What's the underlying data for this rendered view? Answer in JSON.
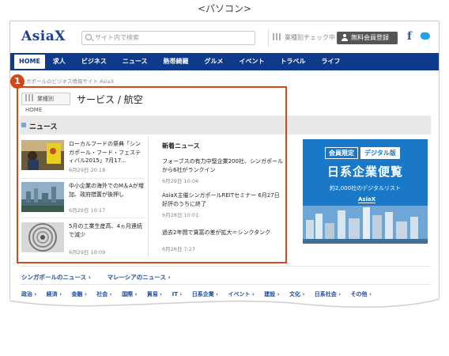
{
  "caption": "<パソコン>",
  "header": {
    "logo": "AsiaX",
    "search_placeholder": "サイト内で検索",
    "industry_check": "業種別チェック中",
    "register": "無料会員登録",
    "facebook": "f"
  },
  "nav": {
    "items": [
      {
        "label": "HOME",
        "active": true
      },
      {
        "label": "求人"
      },
      {
        "label": "ビジネス"
      },
      {
        "label": "ニュース"
      },
      {
        "label": "熱帯綺羅"
      },
      {
        "label": "グルメ"
      },
      {
        "label": "イベント"
      },
      {
        "label": "トラベル"
      },
      {
        "label": "ライフ"
      }
    ]
  },
  "breadcrumb": "ガポールのビジネス情報サイト AsiaX",
  "category": {
    "home_label": "業種別HOME",
    "title": "サービス / 航空"
  },
  "news": {
    "label": "ニュース",
    "thumb_items": [
      {
        "title": "ローカルフードの祭典「シンガポール・フード・フェスティバル2015」7月17...",
        "date": "6月29日 20:18"
      },
      {
        "title": "中小企業の海外でのM＆Aが増加、政府措置が後押し",
        "date": "6月29日 10:17"
      },
      {
        "title": "5月の工業生産高、4ヵ月連続で減少",
        "date": "6月29日 10:09"
      }
    ],
    "latest_heading": "新着ニュース",
    "latest_items": [
      {
        "title": "フォーブスの有力中堅企業200社、シンガポールから6社がランクイン",
        "date": "6月29日 10:06"
      },
      {
        "title": "AsiaX主催シンガポールREITセミナー 6月27日　好評のうちに終了",
        "date": "6月28日 10:01"
      },
      {
        "title": "過去2年間で賃富の差が拡大＝シンクタンク",
        "date": "6月26日 7:27"
      }
    ]
  },
  "ad": {
    "tag1": "会員限定",
    "tag2": "デジタル版",
    "title": "日系企業便覧",
    "subtitle": "約2,000社のデジタルリスト",
    "logo": "AsiaX"
  },
  "badge": "1",
  "region_links": [
    "シンガポールのニュース ›",
    "マレーシアのニュース ›"
  ],
  "category_links": [
    "政治 ›",
    "経済 ›",
    "金融 ›",
    "社会 ›",
    "国際 ›",
    "貿易 ›",
    "IT ›",
    "日系企業 ›",
    "イベント ›",
    "建設 ›",
    "文化 ›",
    "日系社会 ›",
    "その他 ›"
  ],
  "colors": {
    "nav": "#0e3a8c",
    "highlight": "#d2481a",
    "ad": "#1a78c8",
    "link": "#1f4a99"
  }
}
